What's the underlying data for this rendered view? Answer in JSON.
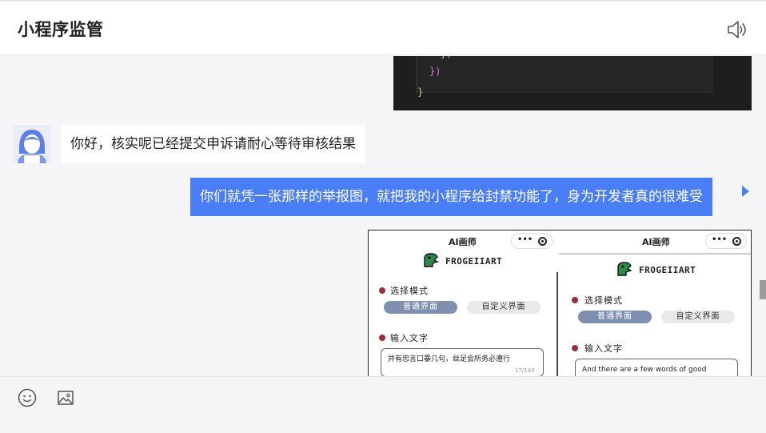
{
  "header": {
    "title": "小程序监管",
    "speaker_icon": "speaker-icon"
  },
  "messages": {
    "code_preview": {
      "line1": "})",
      "line2": "})",
      "line3": "}"
    },
    "incoming": {
      "text": "你好，核实呢已经提交申诉请耐心等待审核结果"
    },
    "outgoing": {
      "text": "你们就凭一张那样的举报图，就把我的小程序给封禁功能了，身为开发者真的很难受"
    },
    "screenshot": {
      "left": {
        "title": "AI画师",
        "capsule_dots": "•••",
        "brand": "FROGEIIART",
        "section1": "选择模式",
        "mode_normal": "普通界面",
        "mode_custom": "自定义界面",
        "section2": "输入文字",
        "input_text": "并有忠言口暴几句，丝足会所务必遵行",
        "counter": "17/140"
      },
      "right": {
        "title": "AI画师",
        "capsule_dots": "•••",
        "brand": "FROGEIIART",
        "section1": "选择模式",
        "mode_normal": "普通界面",
        "mode_custom": "自定义界面",
        "section2": "输入文字",
        "input_text": "And there are a few words of good advice"
      }
    }
  },
  "toolbar": {
    "emoji_icon": "emoji-icon",
    "image_icon": "image-icon"
  },
  "colors": {
    "accent": "#4a7ef7",
    "section_dot": "#9a2f3a",
    "pill_active": "#7f8fb0"
  }
}
